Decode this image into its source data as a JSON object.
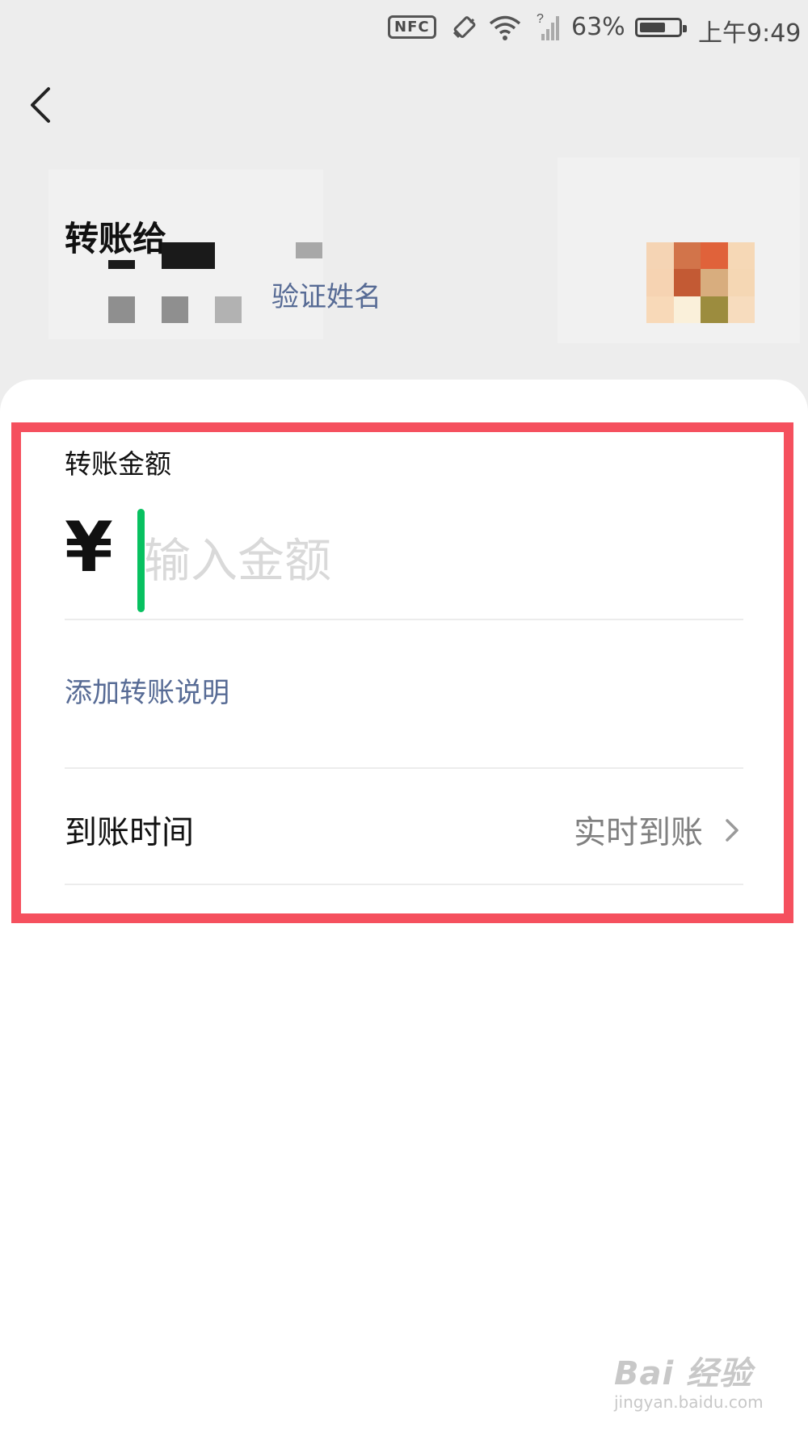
{
  "status_bar": {
    "nfc": "NFC",
    "battery": "63%",
    "time": "上午9:49"
  },
  "header": {
    "title": "转账给",
    "verify_name": "验证姓名"
  },
  "form": {
    "amount_label": "转账金额",
    "currency_symbol": "¥",
    "amount_placeholder": "输入金额",
    "add_remark": "添加转账说明",
    "arrival_label": "到账时间",
    "arrival_value": "实时到账"
  },
  "watermark": {
    "logo": "Bai 经验",
    "url": "jingyan.baidu.com"
  },
  "colors": {
    "accent_green": "#07c160",
    "link_blue": "#576b95",
    "highlight_red": "#f5505e"
  }
}
